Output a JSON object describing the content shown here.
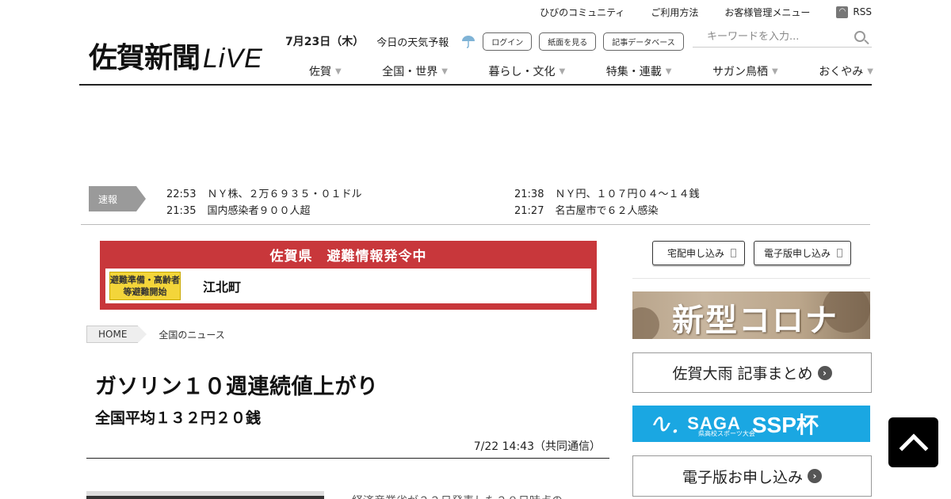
{
  "utility_links": [
    "ひびのコミュニティ",
    "ご利用方法",
    "お客様管理メニュー"
  ],
  "rss_label": "RSS",
  "logo": {
    "jp": "佐賀新聞",
    "live": "LiVE"
  },
  "date": "7月23日（木）",
  "weather_link": "今日の天気予報",
  "weather_icon": "umbrella-icon",
  "header_buttons": [
    "ログイン",
    "紙面を見る",
    "記事データベース"
  ],
  "search": {
    "placeholder": "キーワードを入力..."
  },
  "nav": [
    "佐賀",
    "全国・世界",
    "暮らし・文化",
    "特集・連載",
    "サガン鳥栖",
    "おくやみ"
  ],
  "nav_arrow": "▼",
  "breaking": {
    "label": "速報",
    "items": [
      {
        "time": "22:53",
        "text": "ＮＹ株、２万６９３５・０１ドル"
      },
      {
        "time": "21:38",
        "text": "ＮＹ円、１０７円０４～１４銭"
      },
      {
        "time": "21:35",
        "text": "国内感染者９００人超"
      },
      {
        "time": "21:27",
        "text": "名古屋市で６２人感染"
      }
    ]
  },
  "evacuation": {
    "title": "佐賀県　避難情報発令中",
    "badge": "避難準備・高齢者等避難開始",
    "town": "江北町",
    "color": "#c8373b",
    "badge_color": "#f3d53a"
  },
  "breadcrumb": {
    "home": "HOME",
    "current": "全国のニュース"
  },
  "article": {
    "headline": "ガソリン１０週連続値上がり",
    "subhead": "全国平均１３２円２０銭",
    "dateline": "7/22 14:43（共同通信）",
    "body_start": "経済産業省が２２日発表した２０日時点の"
  },
  "sidebar": {
    "subscribe_buttons": [
      "宅配申し込み",
      "電子版申し込み"
    ],
    "corona_banner": "新型コロナ",
    "heavy_rain_link": "佐賀大雨 記事まとめ",
    "ssp_banner": {
      "mark": "∿.",
      "saga": "SAGA",
      "sub": "県高校スポーツ大会",
      "cup": "SSP杯"
    },
    "digital_link": "電子版お申し込み"
  },
  "back_to_top": "chevron-up-icon"
}
